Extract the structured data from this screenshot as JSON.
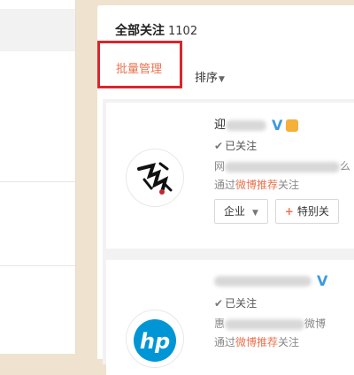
{
  "header": {
    "title": "全部关注",
    "count": "1102"
  },
  "toolbar": {
    "batch_manage": "批量管理",
    "sort": "排序"
  },
  "cards": [
    {
      "name_visible": "迎",
      "verified": "V",
      "status": "已关注",
      "desc_prefix": "网",
      "desc_suffix": "么",
      "via_prefix": "通过",
      "via_link": "微博推荐",
      "via_suffix": "关注",
      "group_label": "企业",
      "special_label": "特别关"
    },
    {
      "verified": "V",
      "status": "已关注",
      "desc_prefix": "惠",
      "desc_suffix": "微博",
      "via_prefix": "通过",
      "via_link": "微博推荐",
      "via_suffix": "关注"
    }
  ],
  "colors": {
    "accent": "#eb7350",
    "highlight_box": "#d9262e",
    "verified": "#3b9ae1"
  },
  "icons": [
    "check-icon",
    "verified-icon",
    "caret-down-icon",
    "plus-icon",
    "vip-badge-icon"
  ]
}
